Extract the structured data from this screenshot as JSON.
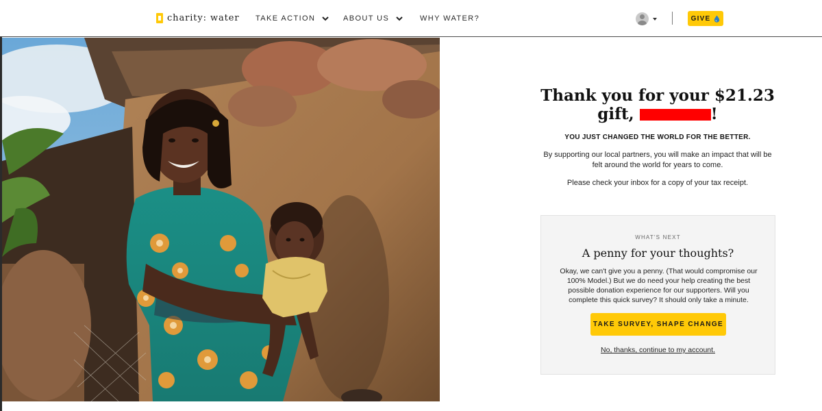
{
  "header": {
    "logo_text": "charity: water",
    "logo_icon": "jerry-can-icon",
    "nav": [
      {
        "label": "TAKE ACTION",
        "has_dropdown": true
      },
      {
        "label": "ABOUT US",
        "has_dropdown": true
      },
      {
        "label": "WHY WATER?",
        "has_dropdown": false
      }
    ],
    "give_label": "GIVE",
    "give_icon": "water-drop-icon",
    "accent_color": "#ffc907"
  },
  "hero": {
    "image_subject": "photo"
  },
  "main": {
    "title_line1": "Thank you for your $21.23",
    "title_line2_prefix": "gift, ",
    "title_line2_suffix": "!",
    "tagline": "YOU JUST CHANGED THE WORLD FOR THE BETTER.",
    "body": "By supporting our local partners, you will make an impact that will be felt around the world for years to come.",
    "receipt_note": "Please check your inbox for a copy of your tax receipt."
  },
  "card": {
    "eyebrow": "WHAT'S NEXT",
    "title": "A penny for your thoughts?",
    "body": "Okay, we can't give you a penny. (That would compromise our 100% Model.) But we do need your help creating the best possible donation experience for our supporters. Will you complete this quick survey? It should only take a minute.",
    "cta_label": "TAKE SURVEY, SHAPE CHANGE",
    "decline_label": "No, thanks, continue to my account."
  }
}
